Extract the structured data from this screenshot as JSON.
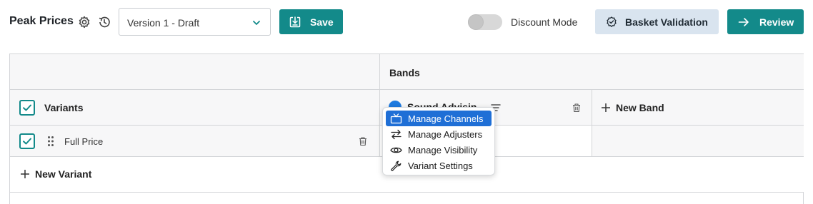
{
  "toolbar": {
    "title": "Peak Prices",
    "version_value": "Version 1 - Draft",
    "save_label": "Save",
    "discount_label": "Discount Mode",
    "discount_on": false,
    "basket_label": "Basket Validation",
    "review_label": "Review"
  },
  "grid": {
    "bands_header": "Bands",
    "variants_header": "Variants",
    "variants_checked": true,
    "band_name": "Sound Advisin",
    "new_band_label": "New Band",
    "rows": [
      {
        "label": "Full Price",
        "checked": true
      }
    ],
    "new_variant_label": "New Variant"
  },
  "context_menu": {
    "items": [
      {
        "label": "Manage Channels",
        "icon": "tv-icon",
        "active": true
      },
      {
        "label": "Manage Adjusters",
        "icon": "arrows-swap-icon",
        "active": false
      },
      {
        "label": "Manage Visibility",
        "icon": "eye-icon",
        "active": false
      },
      {
        "label": "Variant Settings",
        "icon": "wrench-icon",
        "active": false
      }
    ]
  },
  "colors": {
    "accent": "#138a8a",
    "band_dot": "#1f7be0",
    "menu_highlight": "#1f6fd6",
    "basket_bg": "#d9e4ef"
  }
}
